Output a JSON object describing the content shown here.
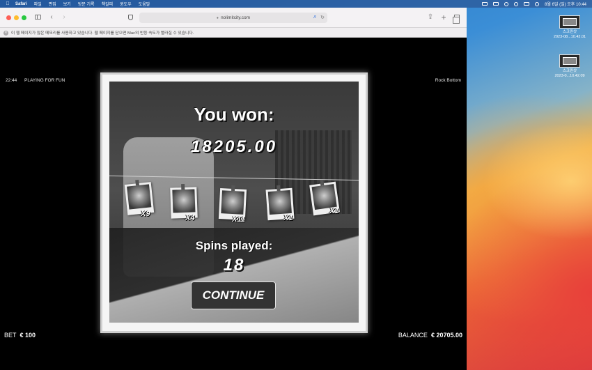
{
  "menubar": {
    "app_name": "Safari",
    "items": [
      "파일",
      "편집",
      "보기",
      "방문 기록",
      "책갈피",
      "윈도우",
      "도움말"
    ],
    "clock": "8월 6일 (일) 오후 10:44"
  },
  "desktop_files": [
    {
      "label1": "스크린샷",
      "label2": "2023-08...10.42.01"
    },
    {
      "label1": "스크린샷",
      "label2": "2023-0...10.42.09"
    }
  ],
  "browser": {
    "url": "nolimitcity.com",
    "info_message": "이 웹 페이지가 많은 메모리를 사용하고 있습니다. 웹 페이지를 닫으면 Mac의 반응 속도가 빨라질 수 있습니다."
  },
  "game": {
    "time": "22:44",
    "mode": "PLAYING FOR FUN",
    "title": "Rock Bottom",
    "won_label": "You won:",
    "won_amount": "18205.00",
    "multipliers": [
      "X9",
      "X4",
      "X11",
      "X1",
      "X1"
    ],
    "spins_label": "Spins played:",
    "spins_count": "18",
    "continue_label": "CONTINUE",
    "bet_label": "BET",
    "bet_value": "€ 100",
    "balance_label": "BALANCE",
    "balance_value": "€ 20705.00"
  }
}
